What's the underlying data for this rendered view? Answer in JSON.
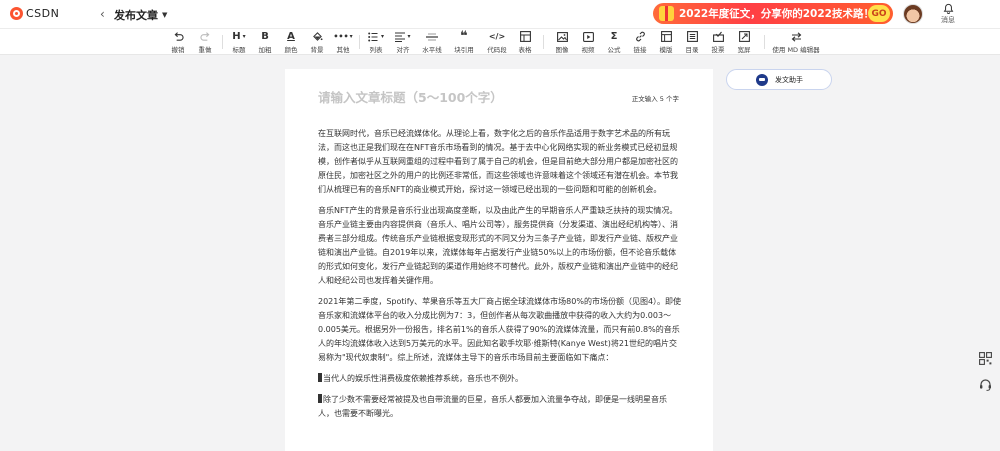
{
  "header": {
    "logo_text": "CSDN",
    "back_glyph": "‹",
    "page_title": "发布文章",
    "banner_text": "2022年度征文，分享你的2022技术路！",
    "banner_coin": "GO",
    "message_label": "消息"
  },
  "toolbar": {
    "undo": "撤销",
    "redo": "重做",
    "heading": "标题",
    "heading_glyph": "H",
    "bold": "加粗",
    "bold_glyph": "B",
    "color": "颜色",
    "color_glyph": "A",
    "background": "背景",
    "other": "其他",
    "other_glyph": "•••",
    "list": "列表",
    "align": "对齐",
    "hr": "水平线",
    "quote": "块引用",
    "code": "代码段",
    "code_glyph": "</>",
    "table": "表格",
    "image": "图像",
    "video": "视频",
    "formula": "公式",
    "formula_glyph": "Σ",
    "link": "链接",
    "template": "模版",
    "toc": "目录",
    "vote": "投票",
    "widescreen": "宽屏",
    "md_editor": "使用 MD 编辑器"
  },
  "editor": {
    "title_placeholder": "请输入文章标题（5～100个字）",
    "counter": "正文输入 5 个字",
    "paragraphs": [
      "在互联网时代，音乐已经流媒体化。从理论上看，数字化之后的音乐作品适用于数字艺术品的所有玩法，而这也正是我们现在在NFT音乐市场看到的情况。基于去中心化网络实现的新业务模式已经初显规模，创作者似乎从互联网重组的过程中看到了属于自己的机会，但是目前绝大部分用户都是加密社区的原住民，加密社区之外的用户的比例还非常低，而这些领域也许意味着这个领域还有潜在机会。本节我们从梳理已有的音乐NFT的商业模式开始，探讨这一领域已经出现的一些问题和可能的创新机会。",
      "音乐NFT产生的背景是音乐行业出现高度垄断，以及由此产生的早期音乐人严重缺乏扶持的现实情况。音乐产业链主要由内容提供商（音乐人、唱片公司等），服务提供商（分发渠道、演出经纪机构等）、消费者三部分组成。传统音乐产业链根据变现形式的不同又分为三条子产业链，即发行产业链、版权产业链和演出产业链。自2019年以来，流媒体每年占据发行产业链50%以上的市场份额，但不论音乐载体的形式如何变化，发行产业链起到的渠道作用始终不可替代。此外，版权产业链和演出产业链中的经纪人和经纪公司也发挥着关键作用。",
      "2021年第二季度，Spotify、苹果音乐等五大厂商占据全球流媒体市场80%的市场份额（见图4）。即使音乐家和流媒体平台的收入分成比例为7：3，但创作者从每次歌曲播放中获得的收入大约为0.003～0.005美元。根据另外一份报告，排名前1%的音乐人获得了90%的流媒体流量，而只有前0.8%的音乐人的年均流媒体收入达到5万美元的水平。因此知名歌手坎耶·维斯特(Kanye West)将21世纪的唱片交易称为\"现代奴隶制\"。综上所述，流媒体主导下的音乐市场目前主要面临如下痛点："
    ],
    "bullets": [
      "当代人的娱乐性消费极度依赖推荐系统，音乐也不例外。",
      "除了少数不需要经常被提及也自带流量的巨星，音乐人都要加入流量争夺战，即便是一线明星音乐人，也需要不断曝光。"
    ]
  },
  "assistant": {
    "label": "发文助手"
  },
  "icons": {
    "qr": "qr-code-icon",
    "support": "headset-icon"
  },
  "colors": {
    "brand": "#fc5531",
    "banner": "#ff3f44",
    "assistant_border": "#c9d4ee"
  }
}
